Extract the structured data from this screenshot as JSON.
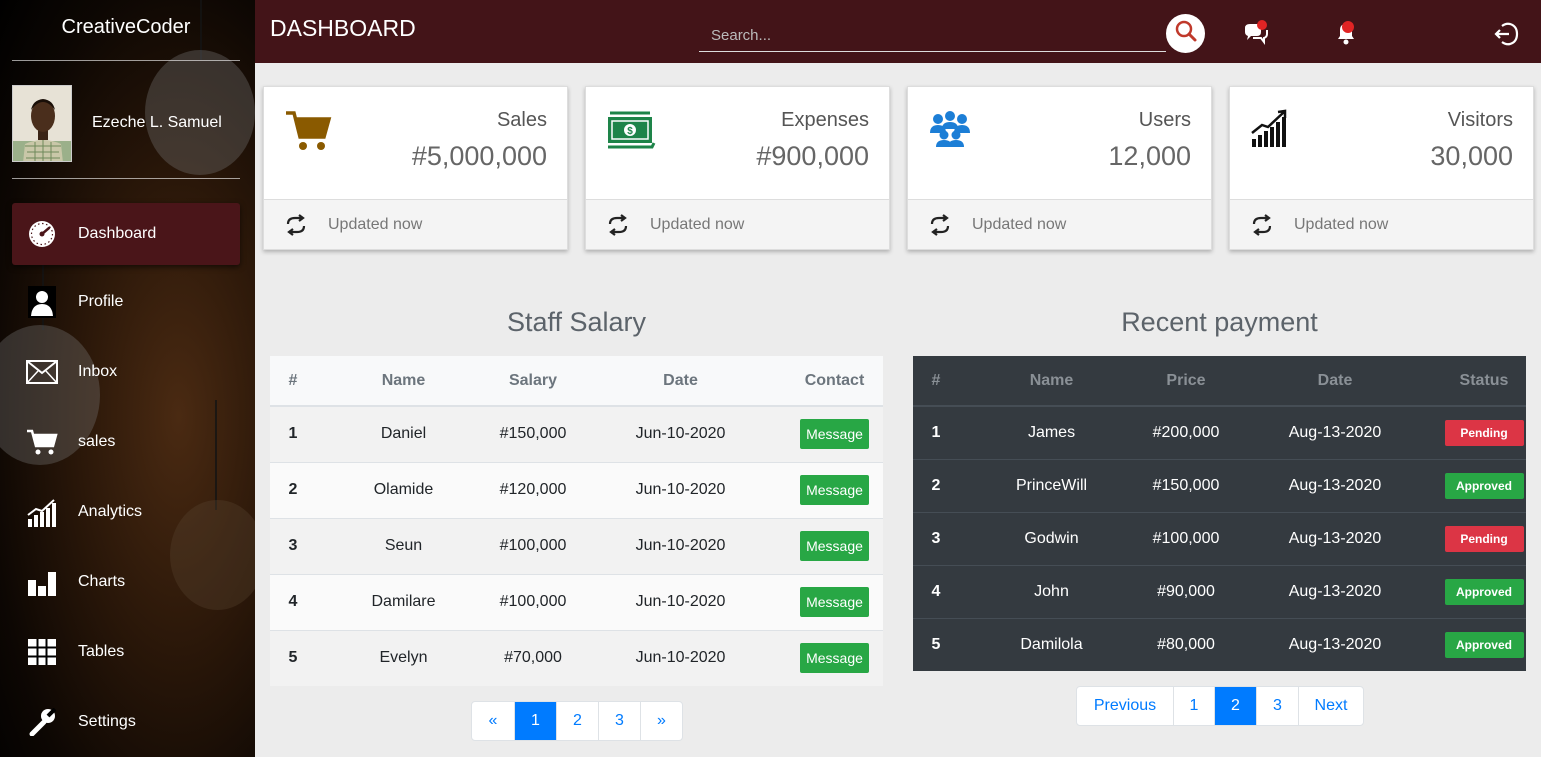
{
  "brand": "CreativeCoder",
  "user": {
    "name": "Ezeche L. Samuel"
  },
  "nav": [
    {
      "label": "Dashboard",
      "icon": "speedometer-icon",
      "active": true
    },
    {
      "label": "Profile",
      "icon": "user-icon"
    },
    {
      "label": "Inbox",
      "icon": "envelope-icon"
    },
    {
      "label": "sales",
      "icon": "cart-icon"
    },
    {
      "label": "Analytics",
      "icon": "analytics-icon"
    },
    {
      "label": "Charts",
      "icon": "bar-chart-icon"
    },
    {
      "label": "Tables",
      "icon": "table-icon"
    },
    {
      "label": "Settings",
      "icon": "wrench-icon"
    }
  ],
  "header": {
    "title": "DASHBOARD",
    "search_placeholder": "Search...",
    "icons": [
      "search-icon",
      "chat-icon",
      "bell-icon",
      "logout-icon"
    ]
  },
  "cards": [
    {
      "label": "Sales",
      "value": "#5,000,000",
      "footer": "Updated now",
      "icon": "cart-icon",
      "color": "#8a5a00"
    },
    {
      "label": "Expenses",
      "value": "#900,000",
      "footer": "Updated now",
      "icon": "money-icon",
      "color": "#1e8449"
    },
    {
      "label": "Users",
      "value": "12,000",
      "footer": "Updated now",
      "icon": "users-icon",
      "color": "#1c7ed6"
    },
    {
      "label": "Visitors",
      "value": "30,000",
      "footer": "Updated now",
      "icon": "growth-chart-icon",
      "color": "#111111"
    }
  ],
  "staff_salary": {
    "title": "Staff Salary",
    "columns": [
      "#",
      "Name",
      "Salary",
      "Date",
      "Contact"
    ],
    "rows": [
      {
        "num": "1",
        "name": "Daniel",
        "salary": "#150,000",
        "date": "Jun-10-2020",
        "action": "Message"
      },
      {
        "num": "2",
        "name": "Olamide",
        "salary": "#120,000",
        "date": "Jun-10-2020",
        "action": "Message"
      },
      {
        "num": "3",
        "name": "Seun",
        "salary": "#100,000",
        "date": "Jun-10-2020",
        "action": "Message"
      },
      {
        "num": "4",
        "name": "Damilare",
        "salary": "#100,000",
        "date": "Jun-10-2020",
        "action": "Message"
      },
      {
        "num": "5",
        "name": "Evelyn",
        "salary": "#70,000",
        "date": "Jun-10-2020",
        "action": "Message"
      }
    ],
    "pagination": {
      "prev": "«",
      "pages": [
        "1",
        "2",
        "3"
      ],
      "active": "1",
      "next": "»"
    }
  },
  "recent_payment": {
    "title": "Recent payment",
    "columns": [
      "#",
      "Name",
      "Price",
      "Date",
      "Status"
    ],
    "rows": [
      {
        "num": "1",
        "name": "James",
        "price": "#200,000",
        "date": "Aug-13-2020",
        "status": "Pending"
      },
      {
        "num": "2",
        "name": "PrinceWill",
        "price": "#150,000",
        "date": "Aug-13-2020",
        "status": "Approved"
      },
      {
        "num": "3",
        "name": "Godwin",
        "price": "#100,000",
        "date": "Aug-13-2020",
        "status": "Pending"
      },
      {
        "num": "4",
        "name": "John",
        "price": "#90,000",
        "date": "Aug-13-2020",
        "status": "Approved"
      },
      {
        "num": "5",
        "name": "Damilola",
        "price": "#80,000",
        "date": "Aug-13-2020",
        "status": "Approved"
      }
    ],
    "pagination": {
      "prev": "Previous",
      "pages": [
        "1",
        "2",
        "3"
      ],
      "active": "2",
      "next": "Next"
    }
  },
  "colors": {
    "header": "#431418",
    "active_nav": "#4a1519",
    "success": "#28a745",
    "danger": "#dc3545",
    "primary": "#007bff"
  }
}
